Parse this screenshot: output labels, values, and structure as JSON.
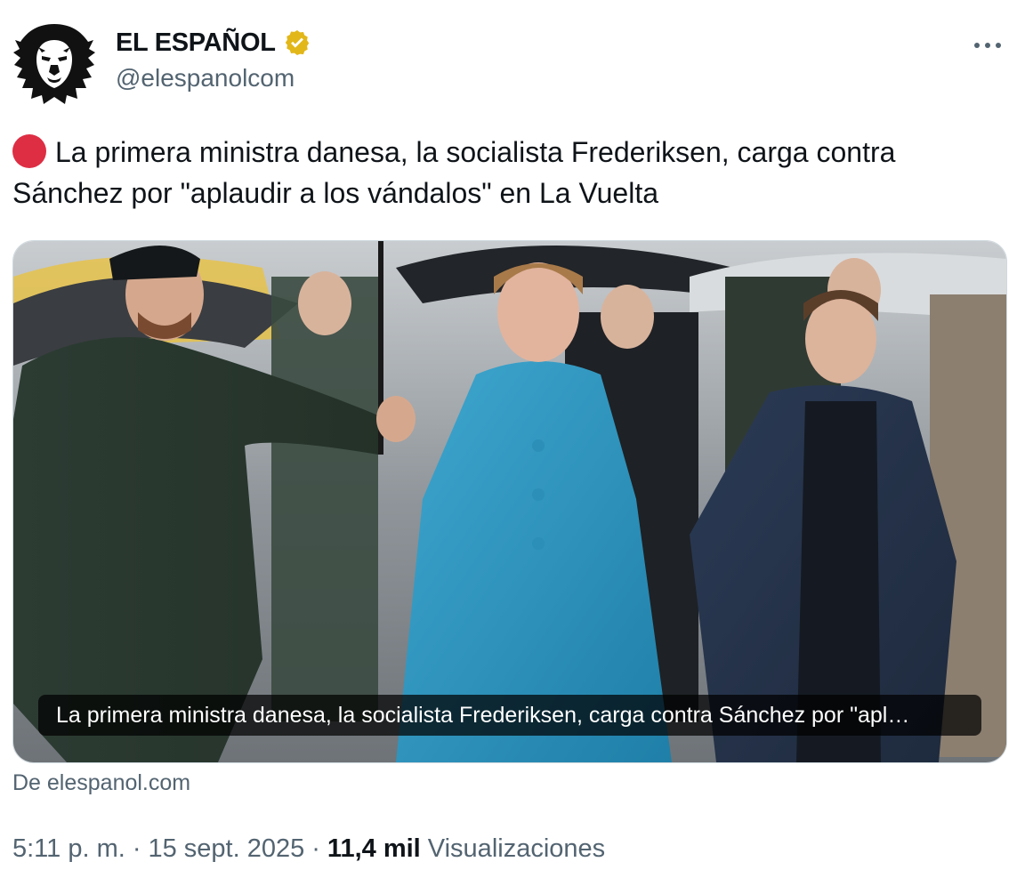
{
  "author": {
    "name": "EL ESPAÑOL",
    "handle": "@elespanolcom",
    "verified": true,
    "verified_color": "#e2b719",
    "avatar_icon": "lion-logo-icon"
  },
  "menu": {
    "icon": "more-options-icon",
    "label": "···"
  },
  "tweet": {
    "emoji": "red-circle",
    "text": "La primera ministra danesa, la socialista Frederiksen, carga contra Sánchez por \"aplaudir a los vándalos\" en La Vuelta"
  },
  "card": {
    "caption": "La primera ministra danesa, la socialista Frederiksen, carga contra Sánchez por \"apl…",
    "source": "De elespanol.com"
  },
  "meta": {
    "time": "5:11 p. m.",
    "dot1": "·",
    "date": "15 sept. 2025",
    "dot2": "·",
    "views_count": "11,4 mil",
    "views_label": "Visualizaciones"
  },
  "colors": {
    "text": "#0f1419",
    "secondary": "#536471",
    "red_circle": "#dd2e44"
  }
}
